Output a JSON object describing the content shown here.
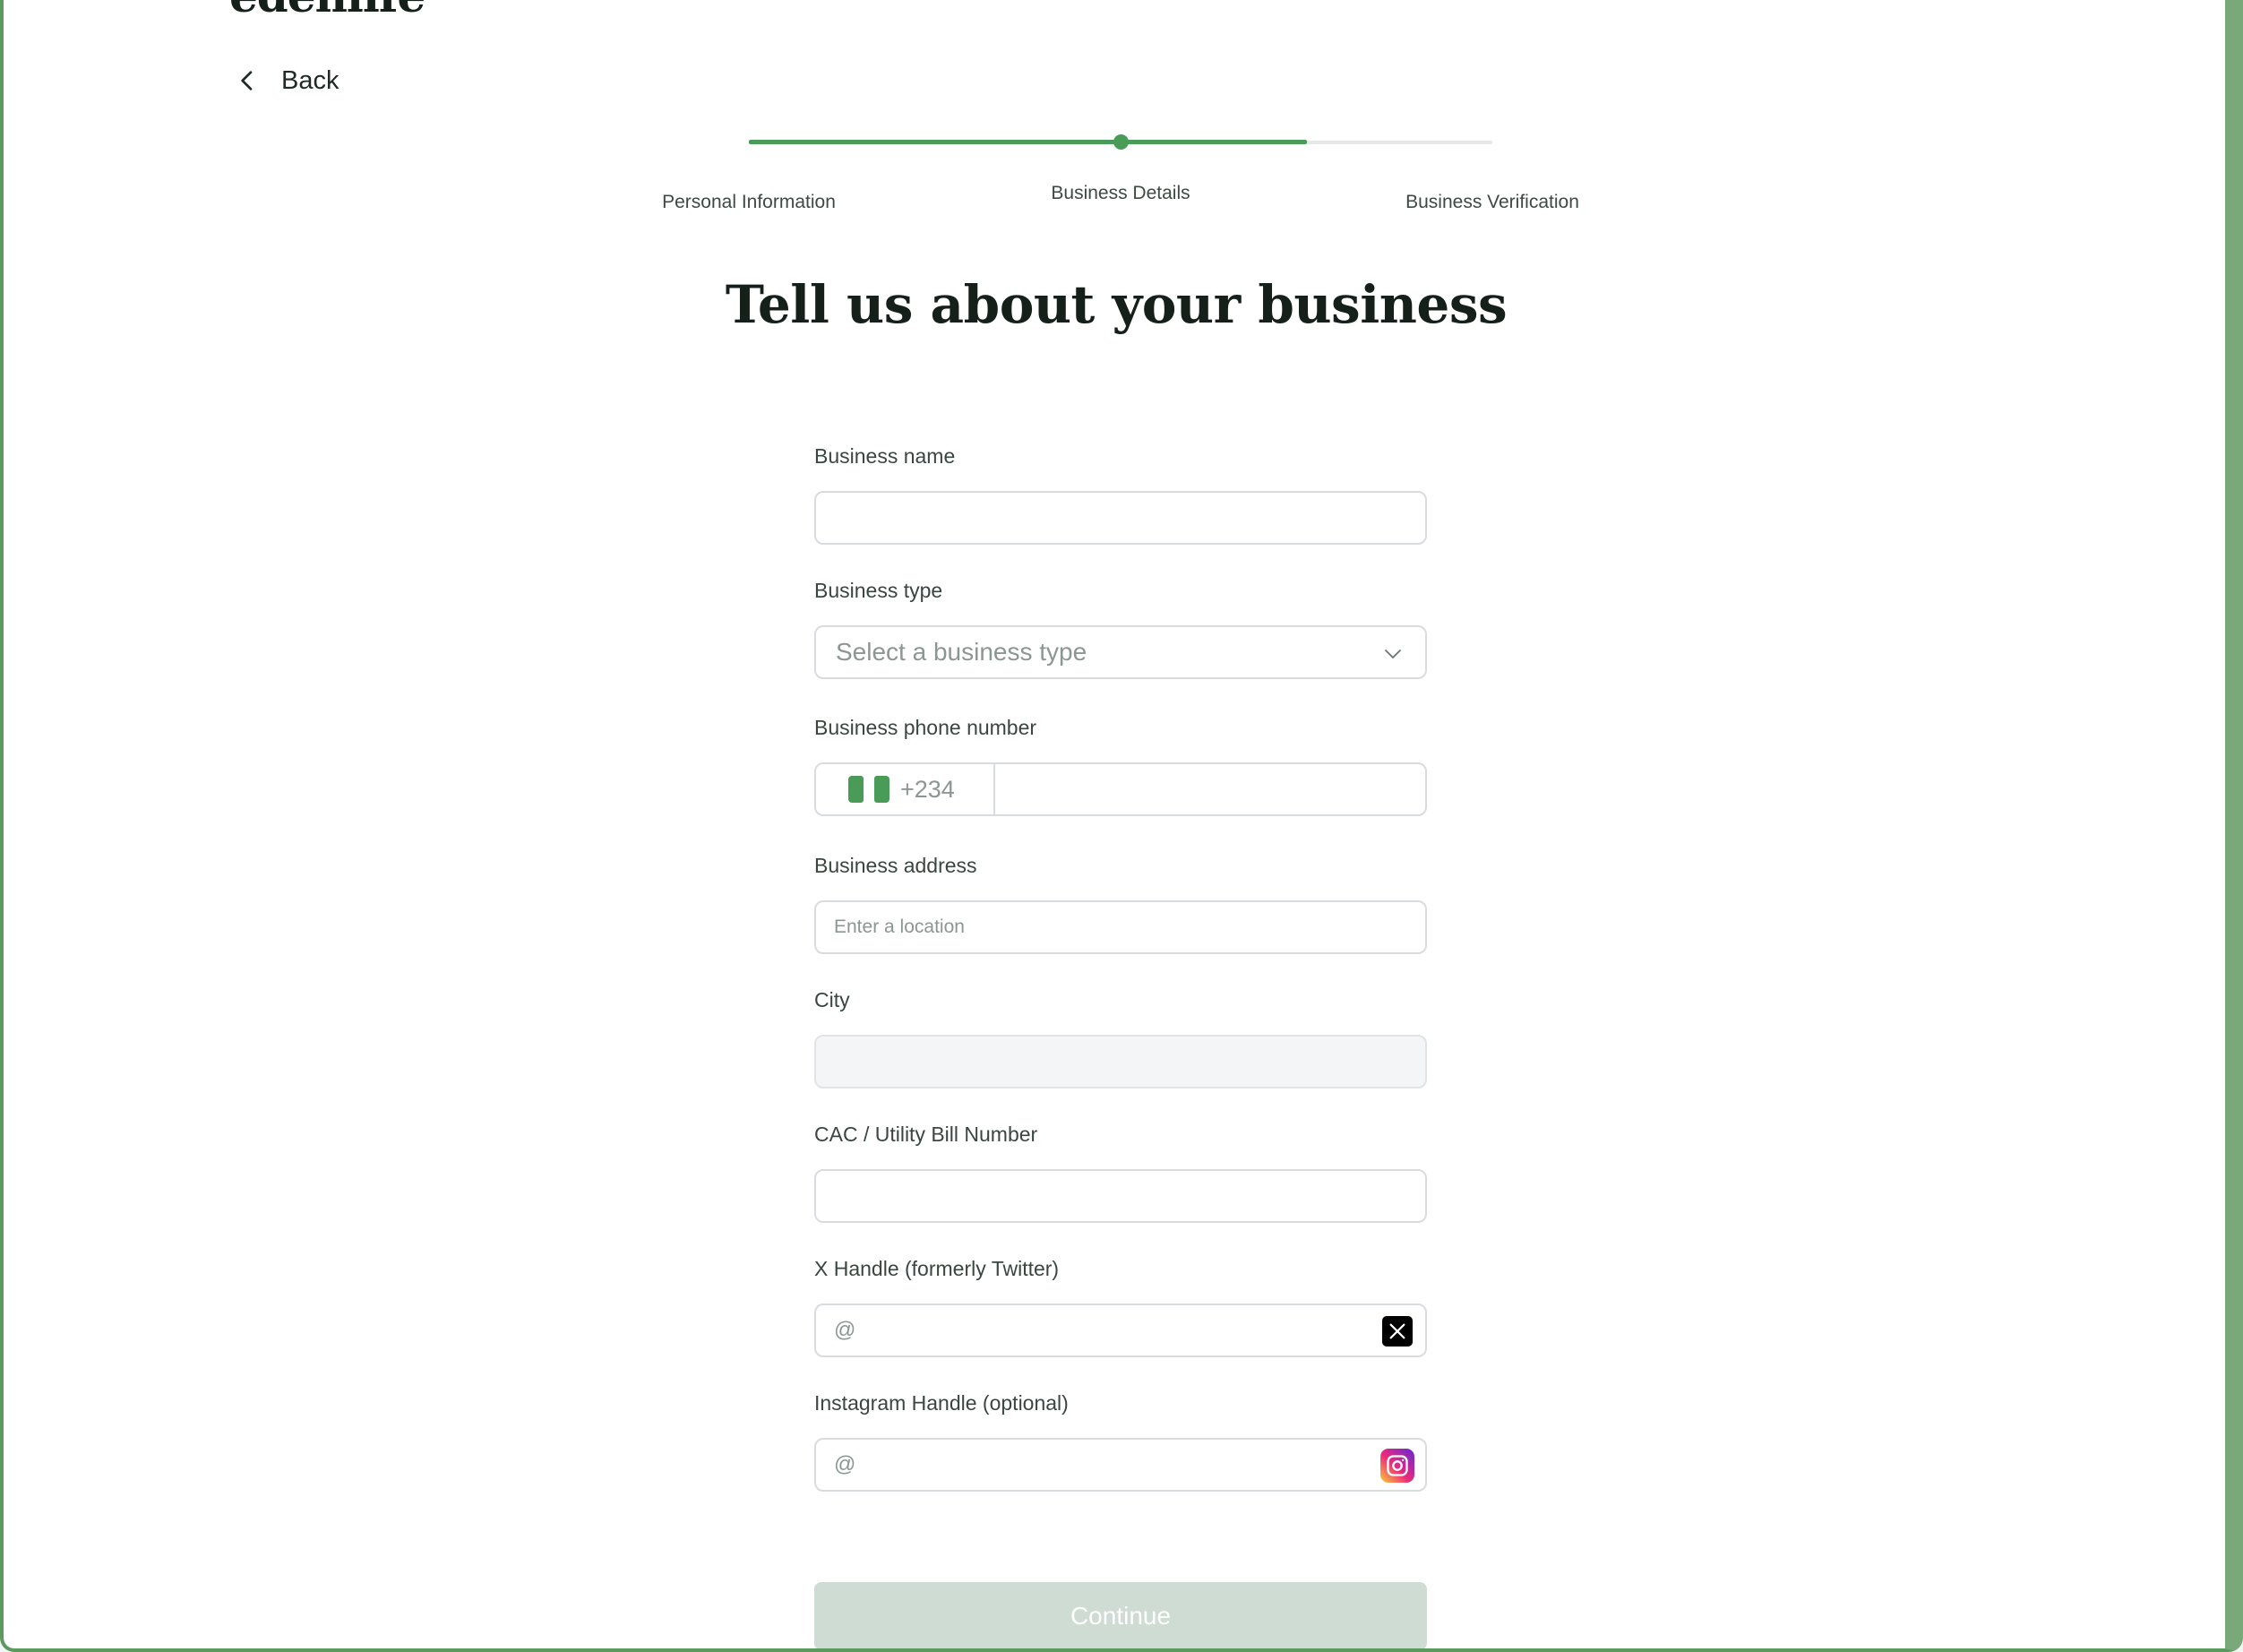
{
  "brand": {
    "logo_text": "edenlife"
  },
  "nav": {
    "back_label": "Back"
  },
  "stepper": {
    "progress": 0.75,
    "current_step": 1,
    "steps": [
      {
        "label": "Personal Information"
      },
      {
        "label": "Business Details"
      },
      {
        "label": "Business Verification"
      }
    ]
  },
  "page": {
    "title": "Tell us about your business"
  },
  "form": {
    "business_name": {
      "label": "Business name",
      "value": "",
      "placeholder": ""
    },
    "business_type": {
      "label": "Business type",
      "placeholder": "Select a business type"
    },
    "business_phone": {
      "label": "Business phone number",
      "dial_code": "+234",
      "country_flag": "nigeria-flag-icon",
      "value": ""
    },
    "business_address": {
      "label": "Business address",
      "placeholder": "Enter a location",
      "value": ""
    },
    "city": {
      "label": "City",
      "value": ""
    },
    "cac_number": {
      "label": "CAC / Utility Bill Number",
      "value": ""
    },
    "x_handle": {
      "label": "X Handle (formerly Twitter)",
      "placeholder": "@",
      "icon": "x-logo-icon"
    },
    "instagram_handle": {
      "label": "Instagram Handle (optional)",
      "placeholder": "@",
      "icon": "instagram-logo-icon"
    }
  },
  "actions": {
    "continue_label": "Continue"
  },
  "colors": {
    "accent": "#4a9a58",
    "button_disabled": "#cfdcd3",
    "frame": "#5a9a5e"
  }
}
